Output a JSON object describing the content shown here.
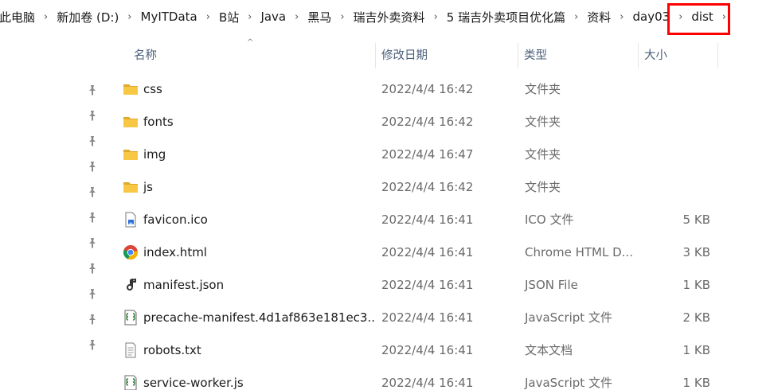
{
  "breadcrumb": {
    "items": [
      "此电脑",
      "新加卷 (D:)",
      "MyITData",
      "B站",
      "Java",
      "黑马",
      "瑞吉外卖资料",
      "5 瑞吉外卖项目优化篇",
      "资料",
      "day03",
      "dist"
    ],
    "separator": "›",
    "highlight_color": "#ff0000"
  },
  "columns": {
    "name": "名称",
    "date": "修改日期",
    "type": "类型",
    "size": "大小",
    "sort_indicator": "^"
  },
  "files": [
    {
      "name": "css",
      "date": "2022/4/4 16:42",
      "type": "文件夹",
      "size": "",
      "icon": "folder-icon"
    },
    {
      "name": "fonts",
      "date": "2022/4/4 16:42",
      "type": "文件夹",
      "size": "",
      "icon": "folder-icon"
    },
    {
      "name": "img",
      "date": "2022/4/4 16:47",
      "type": "文件夹",
      "size": "",
      "icon": "folder-icon"
    },
    {
      "name": "js",
      "date": "2022/4/4 16:42",
      "type": "文件夹",
      "size": "",
      "icon": "folder-icon"
    },
    {
      "name": "favicon.ico",
      "date": "2022/4/4 16:41",
      "type": "ICO 文件",
      "size": "5 KB",
      "icon": "image-file-icon"
    },
    {
      "name": "index.html",
      "date": "2022/4/4 16:41",
      "type": "Chrome HTML D...",
      "size": "3 KB",
      "icon": "chrome-icon"
    },
    {
      "name": "manifest.json",
      "date": "2022/4/4 16:41",
      "type": "JSON File",
      "size": "1 KB",
      "icon": "json-file-icon"
    },
    {
      "name": "precache-manifest.4d1af863e181ec3...",
      "date": "2022/4/4 16:41",
      "type": "JavaScript 文件",
      "size": "2 KB",
      "icon": "script-file-icon"
    },
    {
      "name": "robots.txt",
      "date": "2022/4/4 16:41",
      "type": "文本文档",
      "size": "1 KB",
      "icon": "text-file-icon"
    },
    {
      "name": "service-worker.js",
      "date": "2022/4/4 16:41",
      "type": "JavaScript 文件",
      "size": "1 KB",
      "icon": "script-file-icon"
    }
  ],
  "colors": {
    "folder": "#f8c743",
    "header_text": "#4c607a",
    "meta_text": "#6a6a6a"
  }
}
